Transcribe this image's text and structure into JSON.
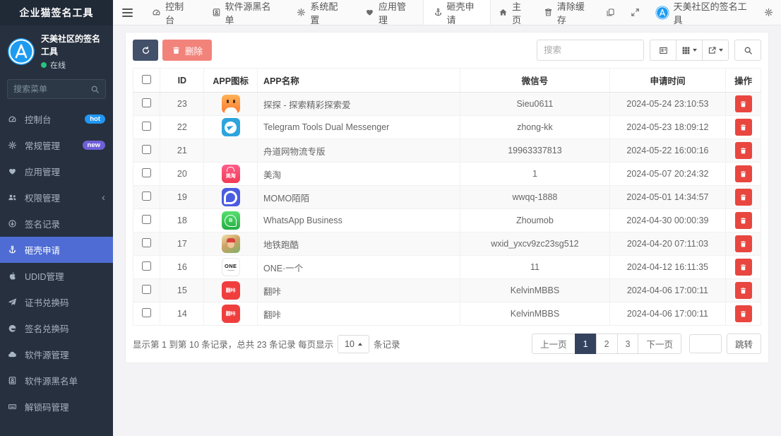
{
  "brand": "企业猫签名工具",
  "colors": {
    "accent": "#4e6cd3",
    "danger": "#e8463f",
    "hot_badge": "#2196f3",
    "new_badge": "#6f5fd8",
    "status_online": "#26c281"
  },
  "sidebar": {
    "user": {
      "name": "天美社区的签名工具",
      "status_label": "在线"
    },
    "search_placeholder": "搜索菜单",
    "items": [
      {
        "label": "控制台",
        "icon": "gauge",
        "badge": "hot"
      },
      {
        "label": "常规管理",
        "icon": "cogs",
        "badge": "new"
      },
      {
        "label": "应用管理",
        "icon": "heart"
      },
      {
        "label": "权限管理",
        "icon": "users",
        "has_submenu": true
      },
      {
        "label": "签名记录",
        "icon": "circle-down"
      },
      {
        "label": "砸壳申请",
        "icon": "anchor",
        "active": true
      },
      {
        "label": "UDID管理",
        "icon": "apple"
      },
      {
        "label": "证书兑换码",
        "icon": "paper-plane"
      },
      {
        "label": "签名兑换码",
        "icon": "edge"
      },
      {
        "label": "软件源管理",
        "icon": "cloud"
      },
      {
        "label": "软件源黑名单",
        "icon": "address-book"
      },
      {
        "label": "解锁码管理",
        "icon": "keyboard"
      }
    ]
  },
  "topnav": {
    "tabs": [
      {
        "label": "控制台",
        "icon": "gauge"
      },
      {
        "label": "软件源黑名单",
        "icon": "address-book"
      },
      {
        "label": "系统配置",
        "icon": "cogs"
      },
      {
        "label": "应用管理",
        "icon": "heart"
      },
      {
        "label": "砸壳申请",
        "icon": "anchor",
        "active": true
      }
    ],
    "home_label": "主页",
    "clear_cache_label": "清除缓存",
    "user_name": "天美社区的签名工具"
  },
  "toolbar": {
    "delete_label": "删除",
    "search_placeholder": "搜索"
  },
  "table": {
    "columns": {
      "id": "ID",
      "icon": "APP图标",
      "name": "APP名称",
      "wechat": "微信号",
      "time": "申请时间",
      "actions": "操作"
    },
    "rows": [
      {
        "id": "23",
        "icon": "tantan",
        "icon_text": "",
        "name": "探探 - 探索精彩探索爱",
        "wechat": "Sieu0611",
        "time": "2024-05-24 23:10:53"
      },
      {
        "id": "22",
        "icon": "telegram",
        "icon_text": "",
        "name": "Telegram Tools Dual Messenger",
        "wechat": "zhong-kk",
        "time": "2024-05-23 18:09:12"
      },
      {
        "id": "21",
        "icon": "none",
        "icon_text": "",
        "name": "舟道网物流专版",
        "wechat": "19963337813",
        "time": "2024-05-22 16:00:16"
      },
      {
        "id": "20",
        "icon": "meitao",
        "icon_text": "美淘",
        "name": "美淘",
        "wechat": "1",
        "time": "2024-05-07 20:24:32"
      },
      {
        "id": "19",
        "icon": "momo",
        "icon_text": "",
        "name": "MOMO陌陌",
        "wechat": "wwqq-1888",
        "time": "2024-05-01 14:34:57"
      },
      {
        "id": "18",
        "icon": "whatsapp",
        "icon_text": "B",
        "name": "WhatsApp Business",
        "wechat": "Zhoumob",
        "time": "2024-04-30 00:00:39"
      },
      {
        "id": "17",
        "icon": "subway",
        "icon_text": "",
        "name": "地铁跑酷",
        "wechat": "wxid_yxcv9zc23sg512",
        "time": "2024-04-20 07:11:03"
      },
      {
        "id": "16",
        "icon": "one",
        "icon_text": "ONE",
        "name": "ONE·一个",
        "wechat": "11",
        "time": "2024-04-12 16:11:35"
      },
      {
        "id": "15",
        "icon": "fanka",
        "icon_text": "翻咔",
        "name": "翻咔",
        "wechat": "KelvinMBBS",
        "time": "2024-04-06 17:00:11"
      },
      {
        "id": "14",
        "icon": "fanka",
        "icon_text": "翻咔",
        "name": "翻咔",
        "wechat": "KelvinMBBS",
        "time": "2024-04-06 17:00:11"
      }
    ]
  },
  "footer": {
    "summary_prefix": "显示第 1 到第 10 条记录，总共 23 条记录 每页显示",
    "page_size": "10",
    "summary_suffix": "条记录",
    "prev_label": "上一页",
    "pages": [
      "1",
      "2",
      "3"
    ],
    "active_page": "1",
    "next_label": "下一页",
    "jump_label": "跳转"
  }
}
